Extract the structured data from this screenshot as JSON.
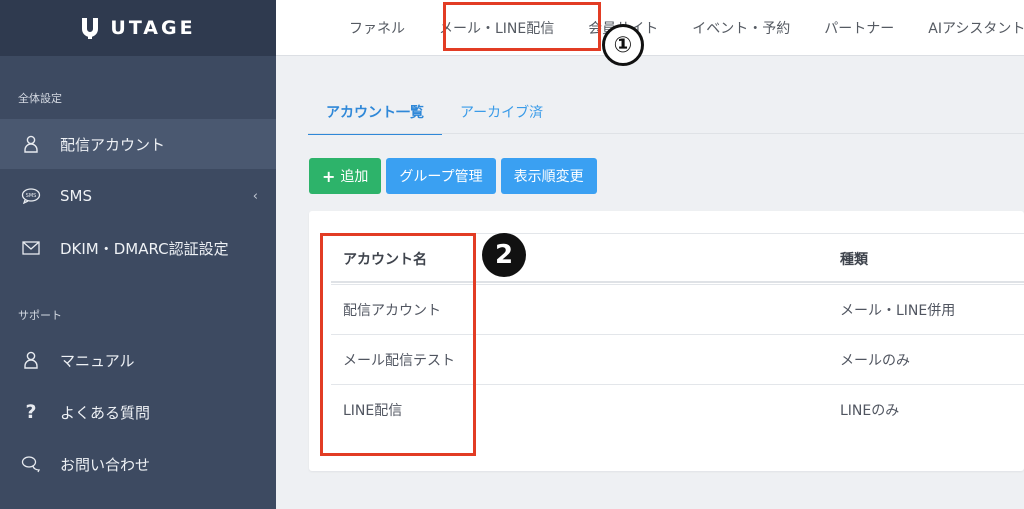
{
  "app": {
    "logo_text": "UTAGE"
  },
  "sidebar": {
    "section_settings": "全体設定",
    "section_support": "サポート",
    "items": [
      {
        "label": "配信アカウント",
        "icon": "user-icon"
      },
      {
        "label": "SMS",
        "icon": "sms-icon"
      },
      {
        "label": "DKIM・DMARC認証設定",
        "icon": "mail-icon"
      },
      {
        "label": "マニュアル",
        "icon": "user-icon"
      },
      {
        "label": "よくある質問",
        "icon": "question-icon"
      },
      {
        "label": "お問い合わせ",
        "icon": "chat-icon"
      }
    ]
  },
  "topnav": {
    "items": [
      "ファネル",
      "メール・LINE配信",
      "会員サイト",
      "イベント・予約",
      "パートナー",
      "AIアシスタント"
    ]
  },
  "annotations": {
    "marker_1": "①",
    "marker_2": "2"
  },
  "tabs": [
    "アカウント一覧",
    "アーカイブ済"
  ],
  "buttons": {
    "add": "追加",
    "add_icon": "+",
    "group_manage": "グループ管理",
    "reorder": "表示順変更"
  },
  "table": {
    "headers": {
      "name": "アカウント名",
      "type": "種類"
    },
    "rows": [
      {
        "name": "配信アカウント",
        "type": "メール・LINE併用"
      },
      {
        "name": "メール配信テスト",
        "type": "メールのみ"
      },
      {
        "name": "LINE配信",
        "type": "LINEのみ"
      }
    ]
  },
  "colors": {
    "sidebar_bg": "#3d4a61",
    "accent_blue": "#3aa0f2",
    "add_green": "#2db36a",
    "highlight_red": "#e23c24"
  }
}
